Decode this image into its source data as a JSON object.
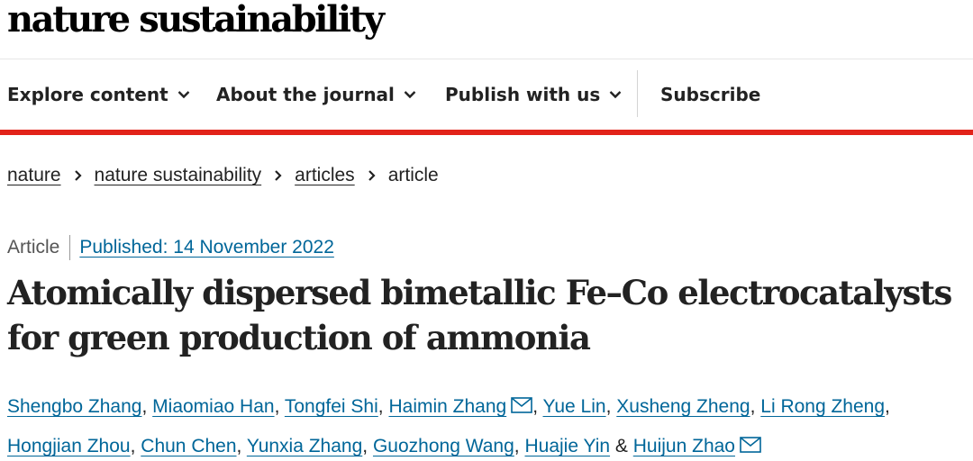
{
  "header": {
    "brand": "nature sustainability"
  },
  "nav": {
    "explore": "Explore content",
    "about": "About the journal",
    "publish": "Publish with us",
    "subscribe": "Subscribe"
  },
  "breadcrumb": {
    "items": [
      "nature",
      "nature sustainability",
      "articles"
    ],
    "current": "article"
  },
  "article": {
    "type": "Article",
    "published": "Published: 14 November 2022",
    "title_line1": "Atomically dispersed bimetallic Fe–Co electrocatalysts",
    "title_line2": "for green production of ammonia",
    "authors": [
      "Shengbo Zhang",
      "Miaomiao Han",
      "Tongfei Shi",
      "Haimin Zhang",
      "Yue Lin",
      "Xusheng Zheng",
      "Li Rong Zheng",
      "Hongjian Zhou",
      "Chun Chen",
      "Yunxia Zhang",
      "Guozhong Wang",
      "Huajie Yin",
      "Huijun Zhao"
    ],
    "author_separator": ",",
    "author_conjunction": "&"
  },
  "icons": {
    "chevron": "chevron-down-icon",
    "breadcrumb_separator": "chevron-right-icon",
    "corresponding_author": "envelope-icon"
  },
  "colors": {
    "link": "#006699",
    "accent_rule": "#e2231a",
    "text": "#222222"
  }
}
